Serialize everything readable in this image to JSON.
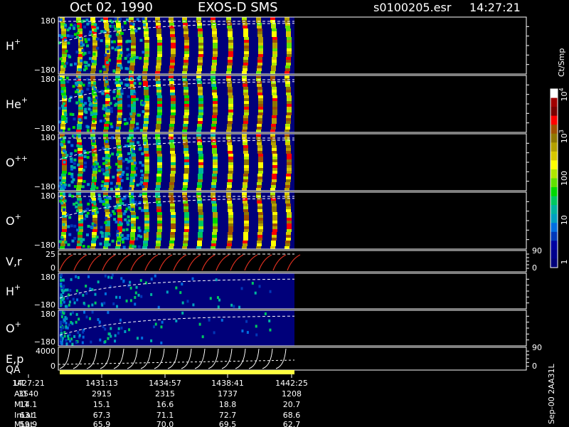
{
  "header": {
    "date": "Oct 02, 1990",
    "instrument": "EXOS-D SMS",
    "file": "s0100205.esr",
    "time": "14:27:21"
  },
  "colorbar": {
    "unit": "Ct/Smp",
    "tick_labels": [
      "1",
      "10",
      "100",
      "10",
      "10"
    ],
    "tick_exponents": [
      "",
      "",
      "",
      "3",
      "4"
    ],
    "tick_values": [
      1,
      10,
      100,
      1000,
      10000
    ],
    "colors": [
      "#00007a",
      "#00008c",
      "#0000a0",
      "#0038b8",
      "#006ee0",
      "#00a0c0",
      "#00b4a0",
      "#00c860",
      "#00d800",
      "#60e000",
      "#b0e800",
      "#ffff00",
      "#d8c800",
      "#b4a000",
      "#907800",
      "#a05000",
      "#ff0000",
      "#7a0000",
      "#a00000",
      "#ffffff"
    ]
  },
  "panels": [
    {
      "id": "h-plus",
      "label": "H",
      "sup": "+",
      "ymax": "180",
      "ymin": "−180",
      "right": "",
      "right2": ""
    },
    {
      "id": "he-plus",
      "label": "He",
      "sup": "+",
      "ymax": "180",
      "ymin": "−180",
      "right": "",
      "right2": ""
    },
    {
      "id": "o-plusplus",
      "label": "O",
      "sup": "++",
      "ymax": "180",
      "ymin": "−180",
      "right": "",
      "right2": ""
    },
    {
      "id": "o-plus",
      "label": "O",
      "sup": "+",
      "ymax": "180",
      "ymin": "−180",
      "right": "",
      "right2": ""
    },
    {
      "id": "vr",
      "label": "V,r",
      "sup": "",
      "ymax": "25",
      "ymin": "0",
      "right": "90",
      "right2": "0"
    },
    {
      "id": "h-plus-2",
      "label": "H",
      "sup": "+",
      "ymax": "180",
      "ymin": "−180",
      "right": "",
      "right2": ""
    },
    {
      "id": "o-plus-2",
      "label": "O",
      "sup": "+",
      "ymax": "180",
      "ymin": "−180",
      "right": "",
      "right2": ""
    },
    {
      "id": "ep",
      "label": "E,p",
      "sup": "",
      "ymax": "4000",
      "ymin": "0",
      "right": "90",
      "right2": "0"
    }
  ],
  "qa_label": "QA",
  "ephemeris": {
    "row_labels": [
      "UT",
      "ALT",
      "MLT",
      "InLat",
      "MLat"
    ],
    "columns": [
      [
        "1427:21",
        "3540",
        "14.1",
        "63.1",
        "59.9"
      ],
      [
        "1431:13",
        "2915",
        "15.1",
        "67.3",
        "65.9"
      ],
      [
        "1434:57",
        "2315",
        "16.6",
        "71.1",
        "70.0"
      ],
      [
        "1438:41",
        "1737",
        "18.8",
        "72.7",
        "69.5"
      ],
      [
        "1442:25",
        "1208",
        "20.7",
        "68.6",
        "62.7"
      ]
    ]
  },
  "footer": "Sep-00 2AA31L",
  "chart_data": {
    "type": "heatmap",
    "x": [
      "1427:21",
      "1431:13",
      "1434:57",
      "1438:41",
      "1442:25"
    ],
    "series": [
      {
        "name": "H+",
        "ylim": [
          -180,
          180
        ]
      },
      {
        "name": "He+",
        "ylim": [
          -180,
          180
        ]
      },
      {
        "name": "O++",
        "ylim": [
          -180,
          180
        ]
      },
      {
        "name": "O+",
        "ylim": [
          -180,
          180
        ]
      },
      {
        "name": "V,r",
        "ylim": [
          0,
          25
        ]
      },
      {
        "name": "H+",
        "ylim": [
          -180,
          180
        ]
      },
      {
        "name": "O+",
        "ylim": [
          -180,
          180
        ]
      },
      {
        "name": "E,p",
        "ylim": [
          0,
          4000
        ]
      }
    ],
    "colorscale": "log",
    "colorbar_range": [
      1,
      10000
    ]
  }
}
